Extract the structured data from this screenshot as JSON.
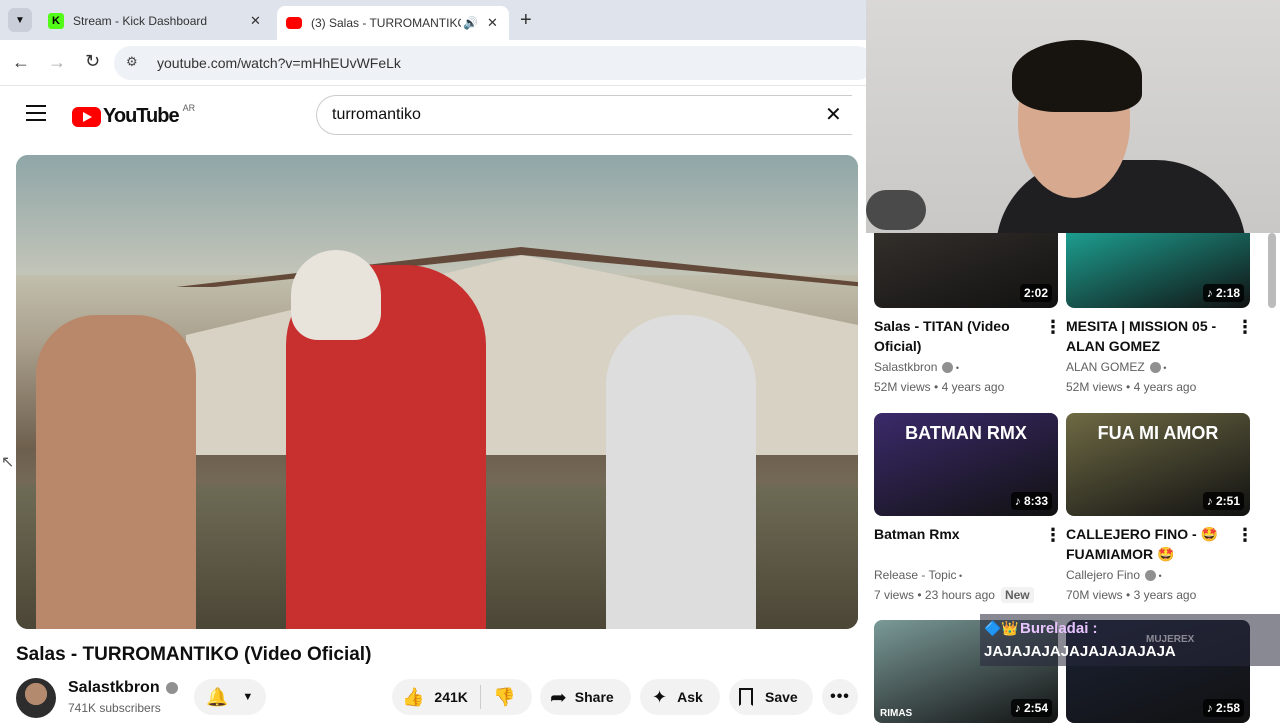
{
  "browser": {
    "tabs": [
      {
        "title": "Stream - Kick Dashboard",
        "icon": "kick-icon",
        "color": "#53fc18"
      },
      {
        "title": "(3) Salas - TURROMANTIKO",
        "icon": "youtube-icon",
        "color": "#ff0000"
      }
    ],
    "url": "youtube.com/watch?v=mHhEUvWFeLk"
  },
  "youtube": {
    "logo": "YouTube",
    "country": "AR",
    "search_value": "turromantiko"
  },
  "video": {
    "title": "Salas - TURROMANTIKO (Video Oficial)",
    "channel": "Salastkbron",
    "subscribers": "741K subscribers",
    "likes": "241K",
    "share": "Share",
    "ask": "Ask",
    "save": "Save"
  },
  "recommendations": [
    {
      "title": "Salas - TITAN (Video Oficial)",
      "channel": "Salastkbron",
      "verified": true,
      "views": "52M views",
      "age": "4 years ago",
      "duration": "2:02",
      "music": false,
      "thumb": "#3a3530"
    },
    {
      "title": "MESITA | MISSION 05 - ALAN GOMEZ",
      "channel": "ALAN GOMEZ",
      "verified": true,
      "views": "52M views",
      "age": "4 years ago",
      "duration": "2:18",
      "music": true,
      "thumb": "#1fb9a8"
    },
    {
      "title": "Batman Rmx",
      "channel": "Release - Topic",
      "verified": false,
      "views": "7 views",
      "age": "23 hours ago",
      "badge": "New",
      "duration": "8:33",
      "music": true,
      "thumb": "#3b2a6b",
      "thumb_text": "BATMAN RMX"
    },
    {
      "title": "CALLEJERO FINO - 🤩 FUAMIAMOR 🤩",
      "channel": "Callejero Fino",
      "verified": true,
      "views": "70M views",
      "age": "3 years ago",
      "duration": "2:51",
      "music": true,
      "thumb": "#6e6a44",
      "thumb_text": "FUA MI AMOR"
    },
    {
      "duration": "2:54",
      "music": true,
      "thumb": "#7a9a98",
      "thumb_text": "RIMAS"
    },
    {
      "duration": "2:58",
      "music": true,
      "thumb": "#1b2235",
      "thumb_text": "MUJEREX"
    }
  ],
  "chat_overlay": {
    "user": "Bureladai :",
    "message": "JAJAJAJAJAJAJAJAJAJA"
  }
}
